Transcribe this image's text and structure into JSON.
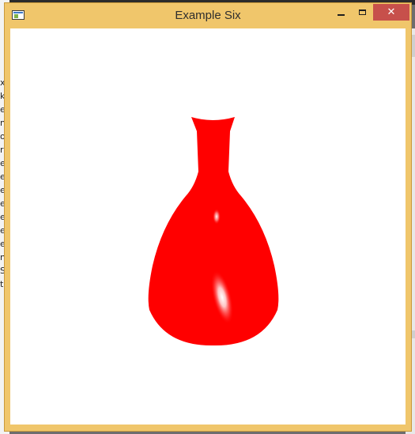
{
  "window": {
    "title": "Example Six",
    "buttons": {
      "minimize": "minimize-icon",
      "maximize": "maximize-icon",
      "close": "close-icon"
    }
  },
  "scene": {
    "object": "vase",
    "color": "#ff0000",
    "highlight_color": "#ffffff",
    "background": "#ffffff"
  },
  "background_fragments": {
    "left_column_chars": [
      "x",
      "k",
      "e",
      "n",
      "o",
      "r",
      "e",
      "e",
      "e",
      "e",
      "e",
      "e",
      "e",
      "n",
      "S",
      "t"
    ]
  }
}
